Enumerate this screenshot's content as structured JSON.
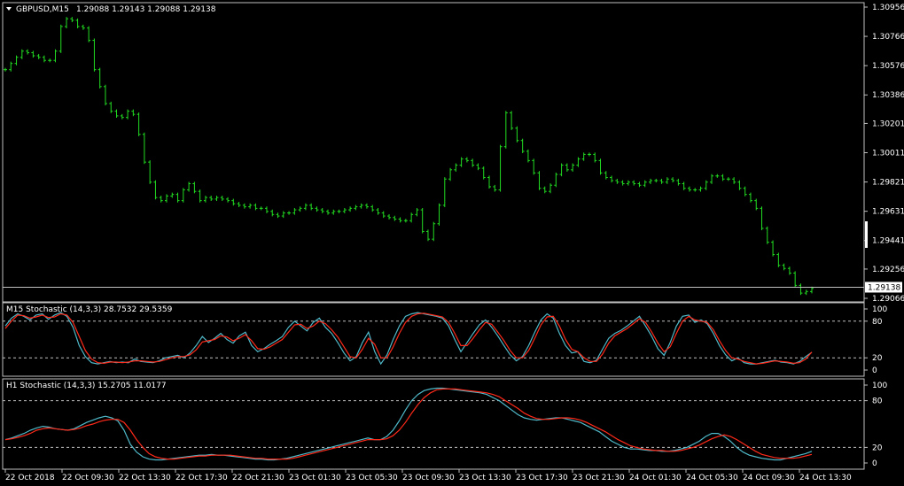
{
  "chart_data": [
    {
      "type": "line",
      "title": "GBPUSD,M15",
      "ohlc_readout": "1.29088 1.29143 1.29088 1.29138",
      "price_ticks": [
        "1.30956",
        "1.30766",
        "1.30576",
        "1.30386",
        "1.30201",
        "1.30011",
        "1.29821",
        "1.29631",
        "1.29441",
        "1.29256",
        "1.29066"
      ],
      "current_price": "1.29138",
      "ylim": [
        1.29066,
        1.30956
      ],
      "x_time_labels": [
        "22 Oct 2018",
        "22 Oct 09:30",
        "22 Oct 13:30",
        "22 Oct 17:30",
        "22 Oct 21:30",
        "23 Oct 01:30",
        "23 Oct 05:30",
        "23 Oct 09:30",
        "23 Oct 13:30",
        "23 Oct 17:30",
        "23 Oct 21:30",
        "24 Oct 01:30",
        "24 Oct 05:30",
        "24 Oct 09:30",
        "24 Oct 13:30"
      ],
      "series": [
        {
          "values": [
            1.3055,
            1.3059,
            1.3063,
            1.3067,
            1.3066,
            1.3064,
            1.3063,
            1.3061,
            1.3061,
            1.3067,
            1.3083,
            1.3088,
            1.3087,
            1.3083,
            1.3082,
            1.3074,
            1.3055,
            1.3044,
            1.3033,
            1.3028,
            1.3025,
            1.3024,
            1.3028,
            1.3026,
            1.3013,
            1.2995,
            1.2982,
            1.2972,
            1.297,
            1.2973,
            1.2974,
            1.297,
            1.2977,
            1.2981,
            1.2976,
            1.297,
            1.2972,
            1.2971,
            1.2972,
            1.2971,
            1.297,
            1.2968,
            1.2967,
            1.2966,
            1.2967,
            1.2965,
            1.2965,
            1.2963,
            1.2961,
            1.296,
            1.2962,
            1.2962,
            1.2964,
            1.2965,
            1.2967,
            1.2965,
            1.2964,
            1.2963,
            1.2962,
            1.2963,
            1.2963,
            1.2964,
            1.2965,
            1.2966,
            1.2967,
            1.2966,
            1.2964,
            1.2962,
            1.296,
            1.2959,
            1.2958,
            1.2957,
            1.2957,
            1.2961,
            1.2964,
            1.295,
            1.2945,
            1.2955,
            1.2967,
            1.2984,
            1.299,
            1.2993,
            1.2997,
            1.2996,
            1.2993,
            1.2991,
            1.2985,
            1.2979,
            1.2977,
            1.3005,
            1.3027,
            1.3017,
            1.3009,
            1.3002,
            1.2996,
            1.2988,
            1.2978,
            1.2976,
            1.298,
            1.2987,
            1.2993,
            1.299,
            1.2993,
            1.2997,
            1.3,
            1.3,
            1.2996,
            1.2988,
            1.2985,
            1.2983,
            1.2982,
            1.2981,
            1.2982,
            1.2981,
            1.298,
            1.2982,
            1.2983,
            1.2983,
            1.2982,
            1.2984,
            1.2983,
            1.2981,
            1.2978,
            1.2977,
            1.2977,
            1.2978,
            1.2982,
            1.2986,
            1.2986,
            1.2984,
            1.2984,
            1.2982,
            1.2978,
            1.2974,
            1.297,
            1.2965,
            1.2952,
            1.2943,
            1.2935,
            1.2928,
            1.2926,
            1.2923,
            1.2915,
            1.291,
            1.2911,
            1.2913
          ]
        }
      ]
    },
    {
      "type": "line",
      "title": "M15 Stochastic (14,3,3) 28.7532 29.5359",
      "ylim": [
        0,
        100
      ],
      "ticks": [
        "100",
        "80",
        "20",
        "0"
      ],
      "levels": [
        80,
        20
      ],
      "series": [
        {
          "color": "#4fb9c9",
          "values": [
            72,
            85,
            92,
            88,
            82,
            90,
            92,
            83,
            90,
            94,
            88,
            70,
            40,
            22,
            12,
            10,
            12,
            14,
            12,
            13,
            12,
            18,
            14,
            13,
            12,
            15,
            20,
            22,
            24,
            20,
            28,
            40,
            55,
            45,
            52,
            60,
            50,
            44,
            56,
            62,
            40,
            30,
            35,
            42,
            48,
            55,
            70,
            80,
            72,
            64,
            78,
            85,
            70,
            60,
            45,
            28,
            15,
            22,
            45,
            62,
            30,
            10,
            25,
            50,
            72,
            88,
            92,
            94,
            92,
            90,
            88,
            85,
            72,
            50,
            30,
            45,
            60,
            74,
            82,
            70,
            56,
            40,
            25,
            15,
            22,
            40,
            62,
            82,
            92,
            85,
            60,
            40,
            28,
            30,
            14,
            12,
            16,
            34,
            52,
            60,
            65,
            72,
            80,
            88,
            72,
            55,
            35,
            24,
            45,
            72,
            88,
            90,
            78,
            82,
            76,
            60,
            40,
            25,
            15,
            20,
            12,
            10,
            10,
            12,
            14,
            16,
            13,
            12,
            10,
            14,
            22,
            29
          ]
        },
        {
          "color": "#ff2a1a",
          "values": [
            68,
            80,
            90,
            89,
            85,
            87,
            90,
            86,
            87,
            92,
            90,
            78,
            55,
            32,
            18,
            12,
            11,
            13,
            13,
            12,
            13,
            15,
            15,
            14,
            13,
            14,
            17,
            20,
            22,
            22,
            25,
            33,
            46,
            48,
            50,
            56,
            54,
            48,
            52,
            58,
            48,
            35,
            34,
            38,
            44,
            50,
            62,
            74,
            75,
            68,
            72,
            80,
            76,
            66,
            54,
            38,
            22,
            20,
            34,
            52,
            42,
            20,
            20,
            38,
            60,
            78,
            88,
            92,
            93,
            91,
            89,
            87,
            78,
            60,
            40,
            40,
            52,
            66,
            78,
            75,
            62,
            48,
            32,
            20,
            20,
            32,
            52,
            74,
            87,
            88,
            72,
            50,
            34,
            30,
            20,
            14,
            14,
            26,
            44,
            56,
            62,
            68,
            76,
            84,
            78,
            62,
            44,
            30,
            38,
            60,
            80,
            88,
            82,
            80,
            78,
            66,
            48,
            32,
            20,
            18,
            14,
            12,
            10,
            11,
            13,
            15,
            14,
            13,
            11,
            12,
            18,
            29.5
          ]
        }
      ]
    },
    {
      "type": "line",
      "title": "H1 Stochastic (14,3,3) 15.2705 11.0177",
      "ylim": [
        0,
        100
      ],
      "ticks": [
        "100",
        "80",
        "20",
        "0"
      ],
      "levels": [
        80,
        20
      ],
      "series": [
        {
          "color": "#4fb9c9",
          "values": [
            30,
            32,
            35,
            38,
            42,
            45,
            47,
            46,
            44,
            43,
            42,
            44,
            48,
            52,
            55,
            58,
            60,
            58,
            54,
            42,
            24,
            14,
            8,
            5,
            4,
            4,
            5,
            6,
            7,
            8,
            9,
            10,
            10,
            11,
            10,
            10,
            9,
            8,
            7,
            6,
            5,
            5,
            4,
            4,
            5,
            6,
            8,
            10,
            12,
            14,
            16,
            18,
            20,
            22,
            24,
            26,
            28,
            30,
            32,
            30,
            30,
            34,
            42,
            54,
            68,
            80,
            88,
            93,
            95,
            96,
            96,
            95,
            94,
            93,
            92,
            91,
            90,
            88,
            84,
            80,
            74,
            68,
            62,
            58,
            56,
            55,
            56,
            57,
            58,
            58,
            56,
            54,
            52,
            48,
            44,
            40,
            34,
            28,
            24,
            20,
            18,
            18,
            17,
            16,
            16,
            15,
            15,
            16,
            18,
            20,
            24,
            28,
            34,
            38,
            38,
            34,
            28,
            20,
            14,
            10,
            8,
            6,
            5,
            4,
            4,
            6,
            8,
            10,
            12,
            15
          ]
        },
        {
          "color": "#ff2a1a",
          "values": [
            30,
            31,
            33,
            35,
            38,
            42,
            44,
            45,
            44,
            43,
            42,
            43,
            45,
            48,
            50,
            53,
            55,
            56,
            56,
            52,
            42,
            30,
            20,
            12,
            8,
            6,
            5,
            5,
            6,
            7,
            8,
            9,
            9,
            10,
            10,
            10,
            10,
            9,
            8,
            7,
            6,
            6,
            5,
            5,
            5,
            5,
            6,
            8,
            10,
            12,
            14,
            16,
            18,
            20,
            22,
            24,
            26,
            28,
            30,
            30,
            30,
            31,
            35,
            42,
            52,
            64,
            75,
            84,
            90,
            94,
            95,
            95,
            95,
            94,
            93,
            92,
            91,
            90,
            88,
            85,
            80,
            75,
            70,
            64,
            60,
            57,
            56,
            56,
            57,
            58,
            58,
            57,
            55,
            52,
            48,
            44,
            40,
            35,
            30,
            26,
            22,
            20,
            18,
            17,
            16,
            16,
            15,
            15,
            16,
            18,
            20,
            23,
            27,
            31,
            34,
            36,
            34,
            30,
            25,
            20,
            15,
            11,
            9,
            7,
            6,
            6,
            6,
            7,
            9,
            11
          ]
        }
      ]
    }
  ]
}
